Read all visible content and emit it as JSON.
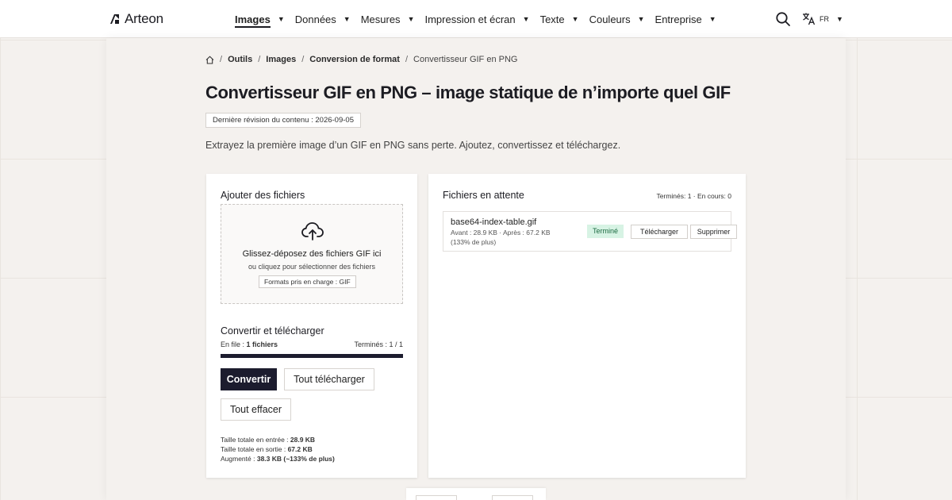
{
  "brand": {
    "name": "Arteon",
    "logo_icon": "arteon-logo-icon"
  },
  "nav": {
    "items": [
      {
        "label": "Images",
        "active": true
      },
      {
        "label": "Données",
        "active": false
      },
      {
        "label": "Mesures",
        "active": false
      },
      {
        "label": "Impression et écran",
        "active": false
      },
      {
        "label": "Texte",
        "active": false
      },
      {
        "label": "Couleurs",
        "active": false
      },
      {
        "label": "Entreprise",
        "active": false
      }
    ],
    "caret": "▼",
    "language": "FR",
    "search_icon": "search-icon",
    "language_icon": "translate-icon"
  },
  "breadcrumb": {
    "home_icon": "home-icon",
    "items": [
      "Outils",
      "Images",
      "Conversion de format"
    ],
    "current": "Convertisseur GIF en PNG",
    "separator": "/"
  },
  "page": {
    "title": "Convertisseur GIF en PNG – image statique de n’importe quel GIF",
    "revision": "Dernière révision du contenu : 2026-09-05",
    "description": "Extrayez la première image d’un GIF en PNG sans perte. Ajoutez, convertissez et téléchargez."
  },
  "upload": {
    "title": "Ajouter des fichiers",
    "drop_main": "Glissez-déposez des fichiers GIF ici",
    "drop_sub": "ou cliquez pour sélectionner des fichiers",
    "formats": "Formats pris en charge : GIF",
    "icon": "cloud-upload-icon"
  },
  "convert": {
    "title": "Convertir et télécharger",
    "queue_label": "En file : ",
    "queue_count": "1 fichiers",
    "done_label": "Terminés : 1 / 1",
    "progress": 1.0,
    "convert_button": "Convertir",
    "download_all_button": "Tout télécharger",
    "clear_button": "Tout effacer"
  },
  "stats": {
    "input_label": "Taille totale en entrée : ",
    "input_value": "28.9 KB",
    "output_label": "Taille totale en sortie : ",
    "output_value": "67.2 KB",
    "change_label": "Augmenté : ",
    "change_value": "38.3 KB (~133% de plus)"
  },
  "queue": {
    "title": "Fichiers en attente",
    "counts": "Terminés: 1 · En cours: 0",
    "files": [
      {
        "name": "base64-index-table.gif",
        "sizes": "Avant : 28.9 KB · Après : 67.2 KB",
        "percent": "(133% de plus)",
        "status": "Terminé",
        "download_button": "Télécharger",
        "delete_button": "Supprimer"
      }
    ]
  },
  "colors": {
    "primary": "#1c1c2e",
    "success_bg": "#d7f3e4",
    "success_text": "#1d6b42",
    "background": "#f4f1ee"
  }
}
